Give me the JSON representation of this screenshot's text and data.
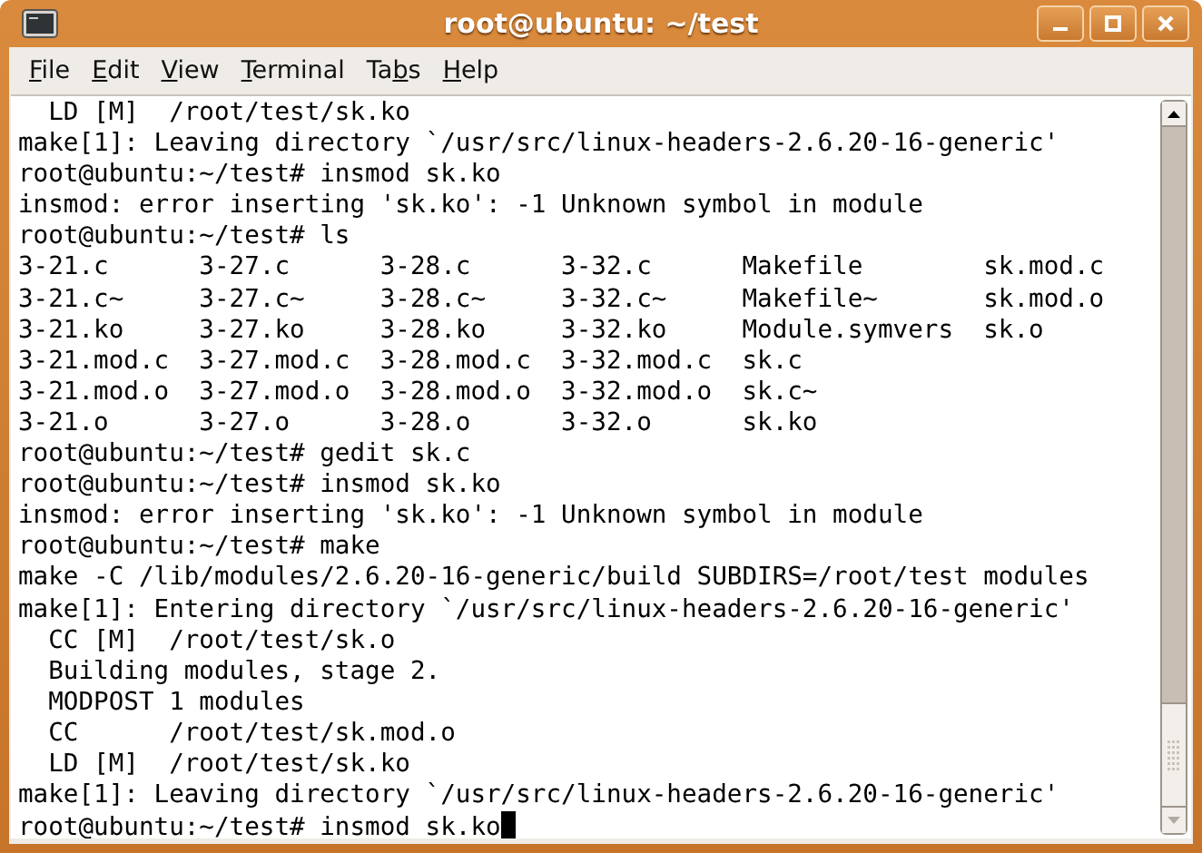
{
  "window": {
    "title": "root@ubuntu: ~/test"
  },
  "menu": [
    {
      "key": "F",
      "post": "ile"
    },
    {
      "key": "E",
      "post": "dit"
    },
    {
      "key": "V",
      "post": "iew"
    },
    {
      "key": "T",
      "post": "erminal"
    },
    {
      "pre": "Ta",
      "key": "b",
      "post": "s"
    },
    {
      "key": "H",
      "post": "elp"
    }
  ],
  "terminal": {
    "lines": [
      "  LD [M]  /root/test/sk.ko",
      "make[1]: Leaving directory `/usr/src/linux-headers-2.6.20-16-generic'",
      "root@ubuntu:~/test# insmod sk.ko",
      "insmod: error inserting 'sk.ko': -1 Unknown symbol in module",
      "root@ubuntu:~/test# ls",
      "3-21.c      3-27.c      3-28.c      3-32.c      Makefile        sk.mod.c",
      "3-21.c~     3-27.c~     3-28.c~     3-32.c~     Makefile~       sk.mod.o",
      "3-21.ko     3-27.ko     3-28.ko     3-32.ko     Module.symvers  sk.o",
      "3-21.mod.c  3-27.mod.c  3-28.mod.c  3-32.mod.c  sk.c",
      "3-21.mod.o  3-27.mod.o  3-28.mod.o  3-32.mod.o  sk.c~",
      "3-21.o      3-27.o      3-28.o      3-32.o      sk.ko",
      "root@ubuntu:~/test# gedit sk.c",
      "root@ubuntu:~/test# insmod sk.ko",
      "insmod: error inserting 'sk.ko': -1 Unknown symbol in module",
      "root@ubuntu:~/test# make",
      "make -C /lib/modules/2.6.20-16-generic/build SUBDIRS=/root/test modules",
      "make[1]: Entering directory `/usr/src/linux-headers-2.6.20-16-generic'",
      "  CC [M]  /root/test/sk.o",
      "  Building modules, stage 2.",
      "  MODPOST 1 modules",
      "  CC      /root/test/sk.mod.o",
      "  LD [M]  /root/test/sk.ko",
      "make[1]: Leaving directory `/usr/src/linux-headers-2.6.20-16-generic'",
      "root@ubuntu:~/test# insmod sk.ko"
    ]
  }
}
